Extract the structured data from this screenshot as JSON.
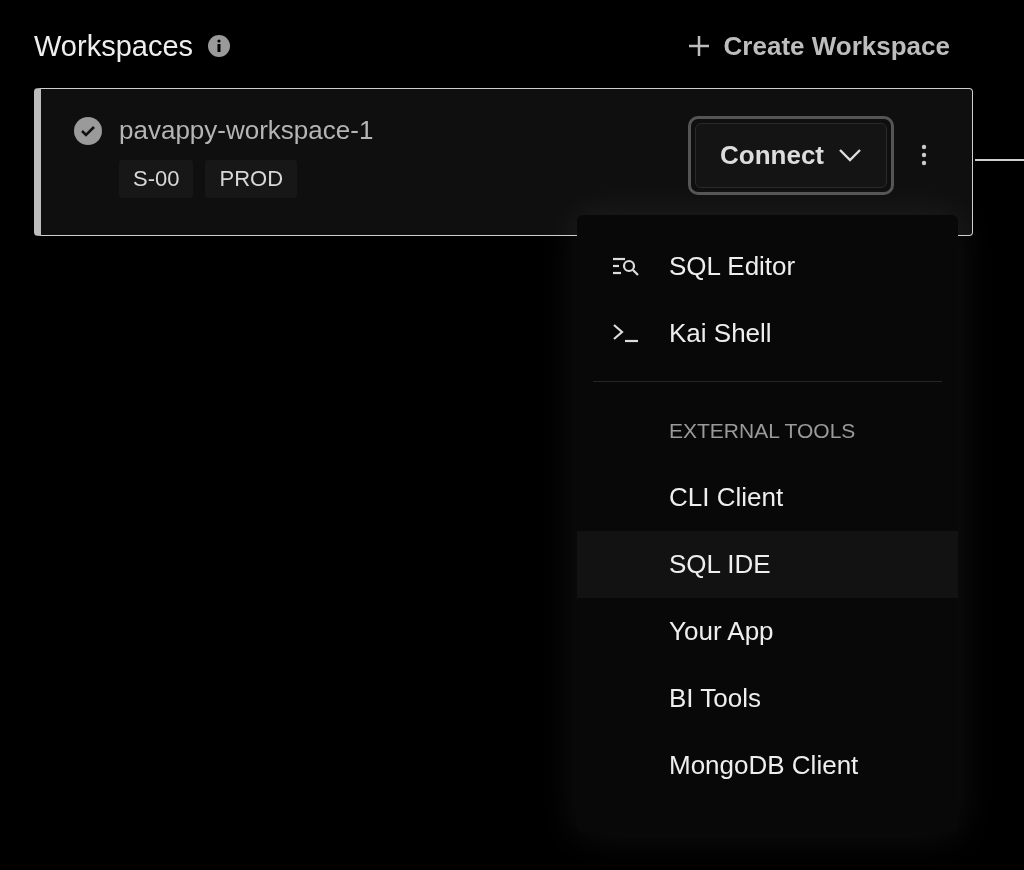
{
  "header": {
    "title": "Workspaces",
    "create_label": "Create Workspace"
  },
  "workspace": {
    "name": "pavappy-workspace-1",
    "connected": true,
    "tags": [
      "S-00",
      "PROD"
    ],
    "connect_label": "Connect",
    "menu_open": true
  },
  "menu": {
    "items": [
      {
        "kind": "editor",
        "label": "SQL Editor",
        "selected": false
      },
      {
        "kind": "shell",
        "label": "Kai Shell",
        "selected": false
      },
      {
        "kind": "divider"
      },
      {
        "kind": "heading",
        "label": "EXTERNAL TOOLS"
      },
      {
        "kind": "plain",
        "label": "CLI Client",
        "selected": false
      },
      {
        "kind": "plain",
        "label": "SQL IDE",
        "selected": true
      },
      {
        "kind": "plain",
        "label": "Your App",
        "selected": false
      },
      {
        "kind": "plain",
        "label": "BI Tools",
        "selected": false
      },
      {
        "kind": "plain",
        "label": "MongoDB Client",
        "selected": false
      }
    ]
  }
}
